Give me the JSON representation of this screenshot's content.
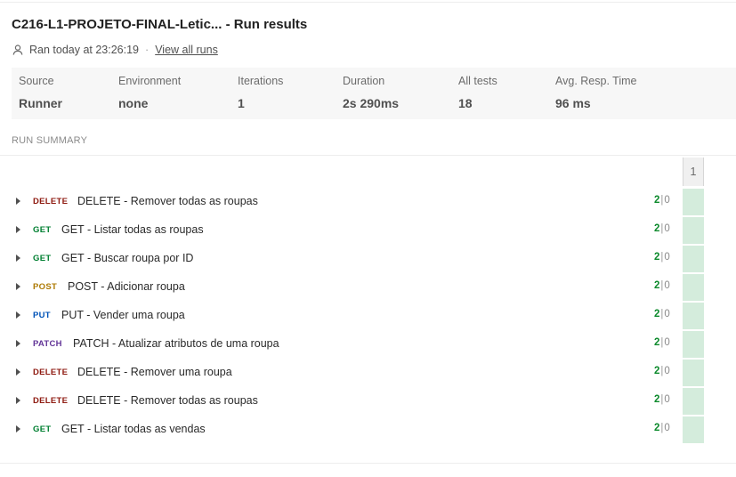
{
  "header": {
    "title": "C216-L1-PROJETO-FINAL-Letic... - Run results",
    "ran_text": "Ran today at 23:26:19",
    "dot": "·",
    "view_all_label": "View all runs"
  },
  "stats": [
    {
      "label": "Source",
      "value": "Runner"
    },
    {
      "label": "Environment",
      "value": "none"
    },
    {
      "label": "Iterations",
      "value": "1"
    },
    {
      "label": "Duration",
      "value": "2s 290ms"
    },
    {
      "label": "All tests",
      "value": "18"
    },
    {
      "label": "Avg. Resp. Time",
      "value": "96 ms"
    }
  ],
  "summary": {
    "label": "RUN SUMMARY",
    "iteration_header": "1",
    "pass_color": "#0c8a2c",
    "cell_color": "#d4ecdc",
    "requests": [
      {
        "method": "DELETE",
        "method_color": "#8e1a10",
        "name": "DELETE - Remover todas as roupas",
        "passed": "2",
        "sep": "|",
        "failed": "0"
      },
      {
        "method": "GET",
        "method_color": "#007f31",
        "name": "GET - Listar todas as roupas",
        "passed": "2",
        "sep": "|",
        "failed": "0"
      },
      {
        "method": "GET",
        "method_color": "#007f31",
        "name": "GET - Buscar roupa por ID",
        "passed": "2",
        "sep": "|",
        "failed": "0"
      },
      {
        "method": "POST",
        "method_color": "#ad7a03",
        "name": "POST - Adicionar roupa",
        "passed": "2",
        "sep": "|",
        "failed": "0"
      },
      {
        "method": "PUT",
        "method_color": "#0053b8",
        "name": "PUT - Vender uma roupa",
        "passed": "2",
        "sep": "|",
        "failed": "0"
      },
      {
        "method": "PATCH",
        "method_color": "#623497",
        "name": "PATCH - Atualizar atributos de uma roupa",
        "passed": "2",
        "sep": "|",
        "failed": "0"
      },
      {
        "method": "DELETE",
        "method_color": "#8e1a10",
        "name": "DELETE - Remover uma roupa",
        "passed": "2",
        "sep": "|",
        "failed": "0"
      },
      {
        "method": "DELETE",
        "method_color": "#8e1a10",
        "name": "DELETE - Remover todas as roupas",
        "passed": "2",
        "sep": "|",
        "failed": "0"
      },
      {
        "method": "GET",
        "method_color": "#007f31",
        "name": "GET - Listar todas as vendas",
        "passed": "2",
        "sep": "|",
        "failed": "0"
      }
    ]
  }
}
